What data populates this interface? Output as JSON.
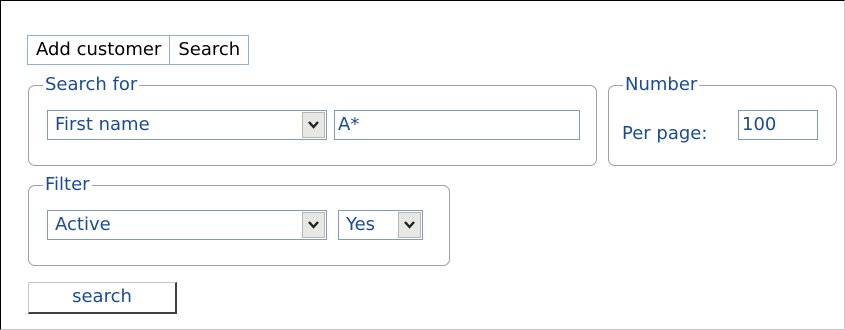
{
  "tabs": [
    {
      "label": "Add customer"
    },
    {
      "label": "Search"
    }
  ],
  "search_for": {
    "legend": "Search for",
    "field_select": {
      "value": "First name",
      "icon": "chevron-down-icon"
    },
    "query_input": {
      "value": "A*"
    }
  },
  "number": {
    "legend": "Number",
    "per_page_label": "Per page:",
    "per_page_input": {
      "value": "100"
    }
  },
  "filter": {
    "legend": "Filter",
    "field_select": {
      "value": "Active",
      "icon": "chevron-down-icon"
    },
    "value_select": {
      "value": "Yes",
      "icon": "chevron-down-icon"
    }
  },
  "search_button": {
    "label": "search"
  },
  "colors": {
    "text_blue": "#1a4b97",
    "tab_border": "#8fb0d9",
    "input_border": "#7f9db9",
    "group_border": "#a0a0a0"
  }
}
